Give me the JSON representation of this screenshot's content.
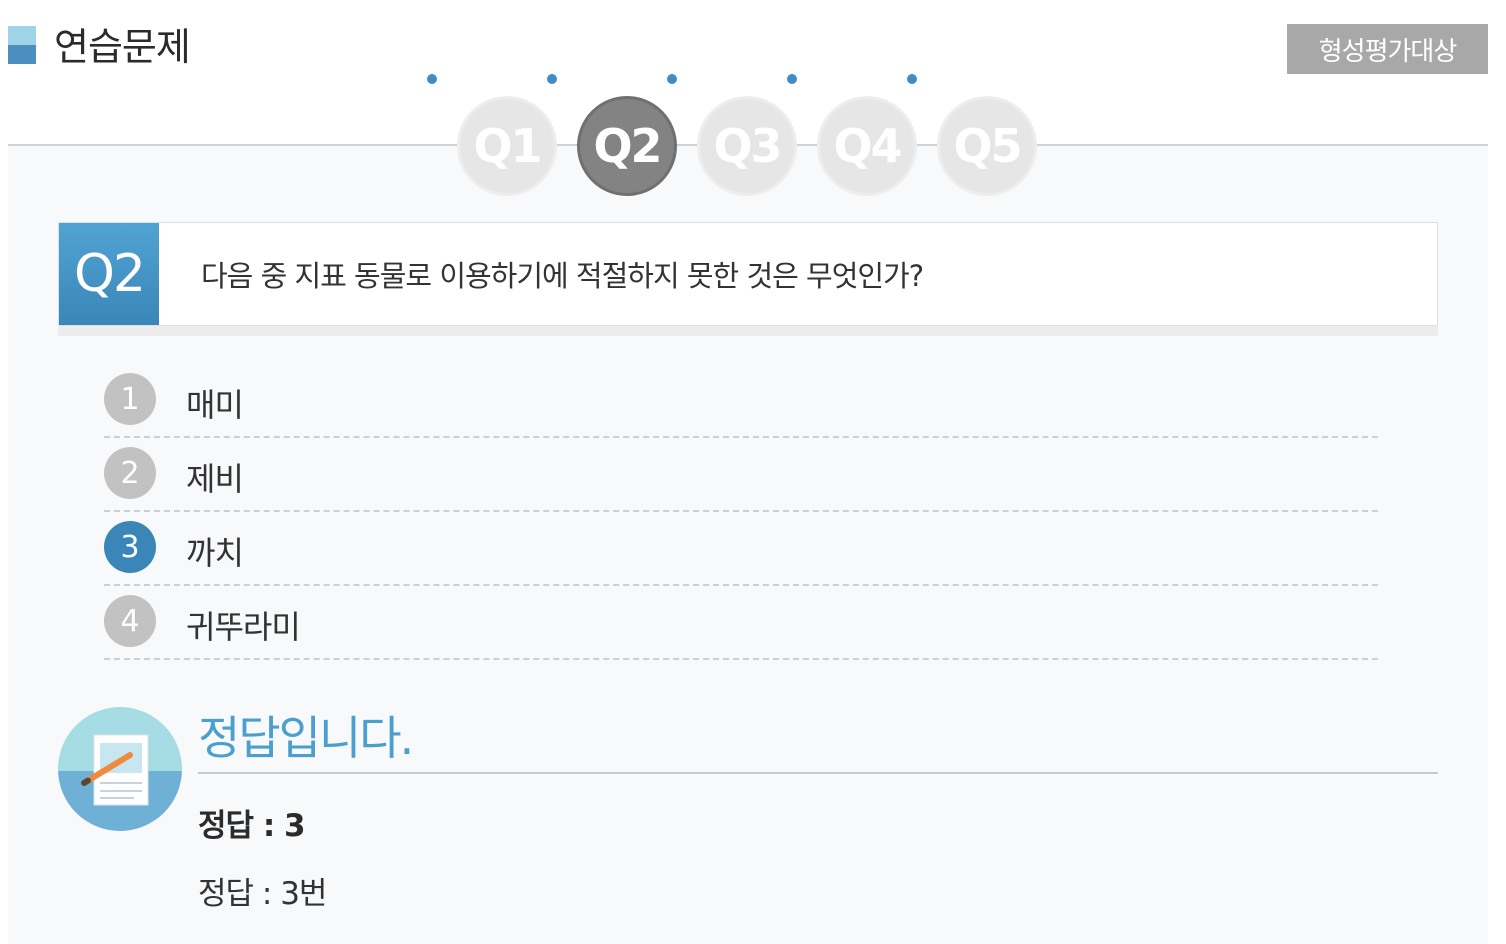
{
  "header": {
    "title": "연습문제",
    "badge": "형성평가대상"
  },
  "tabs": [
    {
      "label": "Q1",
      "active": false
    },
    {
      "label": "Q2",
      "active": true
    },
    {
      "label": "Q3",
      "active": false
    },
    {
      "label": "Q4",
      "active": false
    },
    {
      "label": "Q5",
      "active": false
    }
  ],
  "question": {
    "number": "Q2",
    "text": "다음 중 지표 동물로 이용하기에 적절하지 못한 것은 무엇인가?"
  },
  "options": [
    {
      "num": "1",
      "label": "매미",
      "selected": false
    },
    {
      "num": "2",
      "label": "제비",
      "selected": false
    },
    {
      "num": "3",
      "label": "까치",
      "selected": true
    },
    {
      "num": "4",
      "label": "귀뚜라미",
      "selected": false
    }
  ],
  "result": {
    "title": "정답입니다.",
    "answer_bold": "정답 : 3",
    "answer_text": "정답 : 3번",
    "icon": "notepad-pencil-icon"
  },
  "colors": {
    "accent": "#3a86b8",
    "accent_light": "#4a9fce",
    "inactive": "#c2c2c2",
    "badge": "#a8a8a8"
  }
}
